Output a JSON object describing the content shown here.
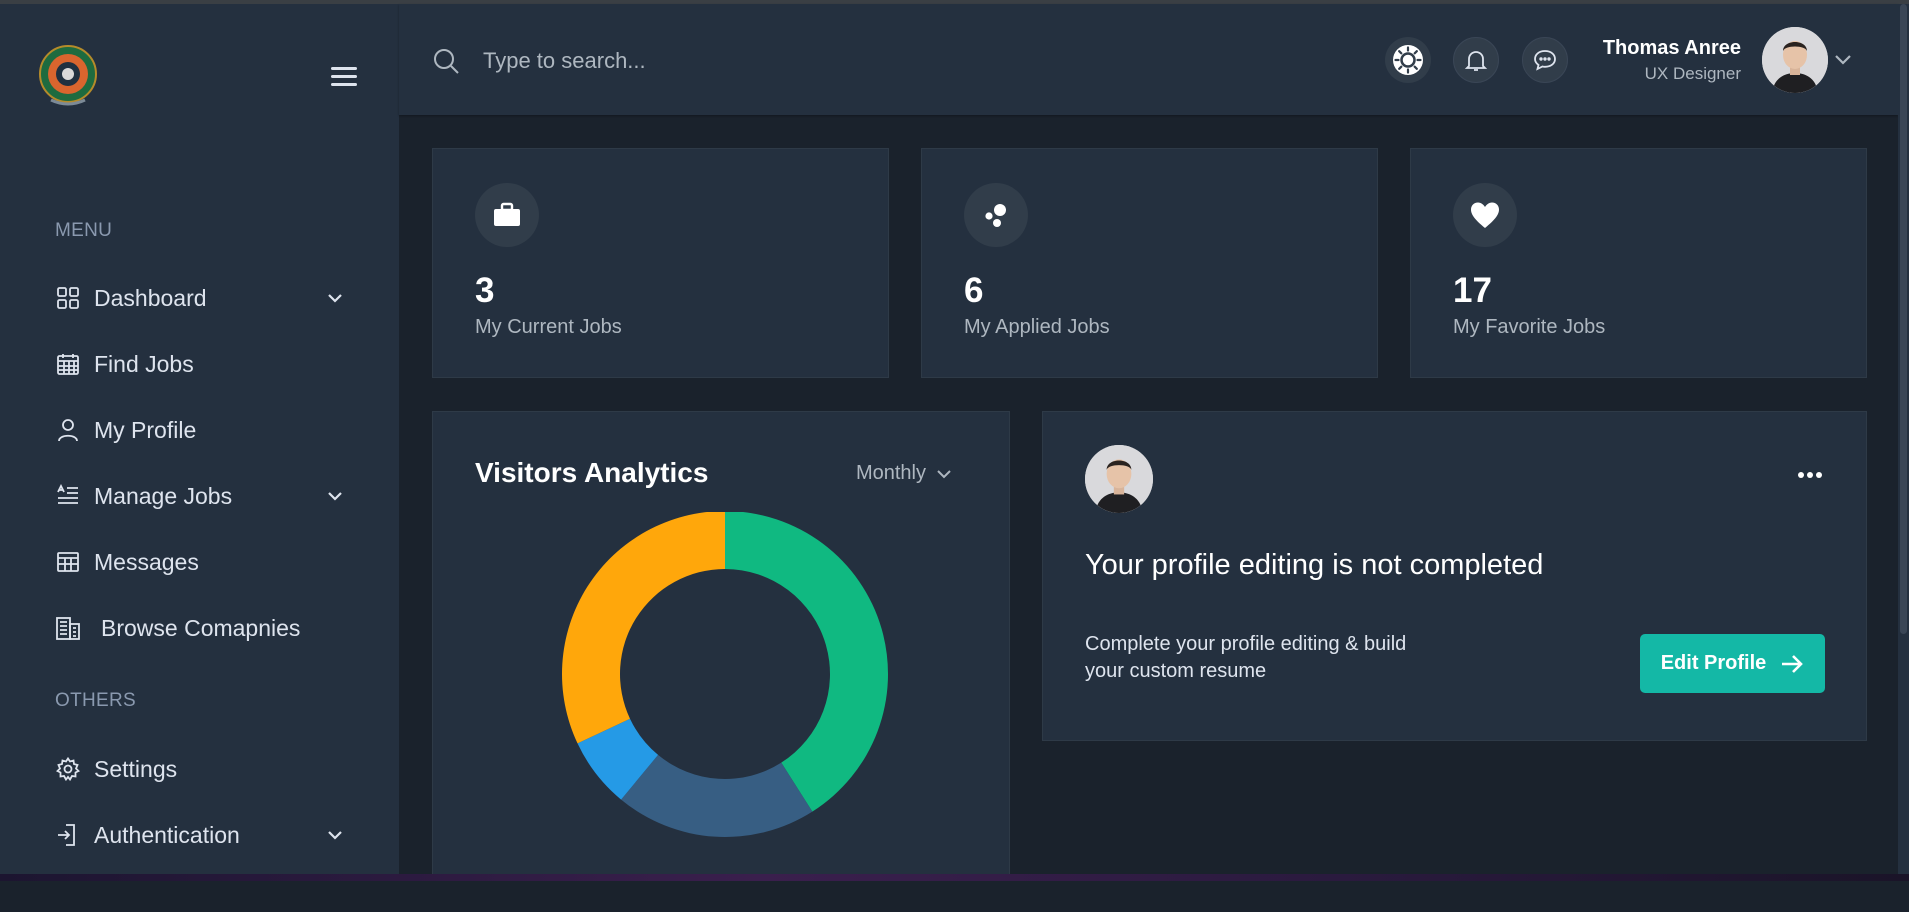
{
  "sidebar": {
    "menu_title": "MENU",
    "others_title": "OTHERS",
    "items": [
      {
        "label": "Dashboard",
        "icon": "grid-icon",
        "has_chevron": true
      },
      {
        "label": "Find Jobs",
        "icon": "calendar-icon",
        "has_chevron": false
      },
      {
        "label": "My Profile",
        "icon": "user-icon",
        "has_chevron": false
      },
      {
        "label": "Manage Jobs",
        "icon": "list-icon",
        "has_chevron": true
      },
      {
        "label": "Messages",
        "icon": "table-icon",
        "has_chevron": false
      },
      {
        "label": "Browse Comapnies",
        "icon": "building-icon",
        "has_chevron": false
      }
    ],
    "others": [
      {
        "label": "Settings",
        "icon": "gear-icon",
        "has_chevron": false
      },
      {
        "label": "Authentication",
        "icon": "login-icon",
        "has_chevron": true
      }
    ]
  },
  "header": {
    "search_placeholder": "Type to search...",
    "user_name": "Thomas Anree",
    "user_role": "UX Designer"
  },
  "stats": [
    {
      "value": "3",
      "label": "My Current Jobs",
      "icon": "briefcase-icon"
    },
    {
      "value": "6",
      "label": "My Applied Jobs",
      "icon": "dots-icon"
    },
    {
      "value": "17",
      "label": "My Favorite Jobs",
      "icon": "heart-icon"
    }
  ],
  "analytics": {
    "title": "Visitors Analytics",
    "period": "Monthly"
  },
  "chart_data": {
    "type": "pie",
    "variant": "donut",
    "values": [
      41,
      20,
      7,
      32
    ],
    "colors": [
      "#10b981",
      "#375e83",
      "#259ae6",
      "#ffa70b"
    ]
  },
  "profile_card": {
    "title": "Your profile editing is not completed",
    "description": "Complete your profile editing & build your custom resume",
    "button_label": "Edit Profile"
  },
  "colors": {
    "sidebar_bg": "#24303f",
    "page_bg": "#1a222c",
    "accent": "#14b8a6"
  }
}
